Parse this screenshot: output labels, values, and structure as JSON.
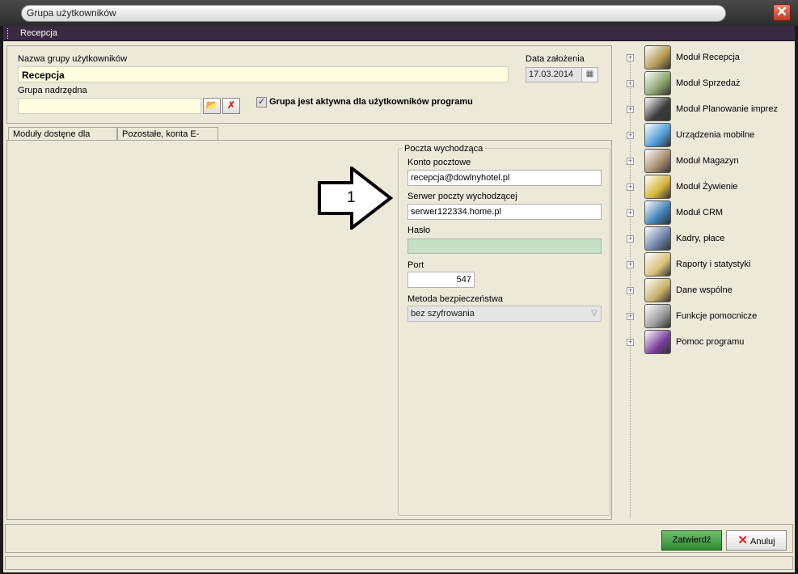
{
  "window": {
    "title": "Grupa użytkowników",
    "close_glyph": "✕"
  },
  "menubar": {
    "label": "Recepcja"
  },
  "form": {
    "name_label": "Nazwa grupy użytkowników",
    "name_value": "Recepcja",
    "parent_label": "Grupa nadrzędna",
    "parent_value": "",
    "date_label": "Data założenia",
    "date_value": "17.03.2014",
    "active_checked": true,
    "active_label": "Grupa jest aktywna dla użytkowników programu"
  },
  "tabs": [
    {
      "label": "Moduły dostęne dla grupy"
    },
    {
      "label": "Pozostałe, konta E-mail"
    }
  ],
  "mail": {
    "group_title": "Poczta wychodząca",
    "account_label": "Konto pocztowe",
    "account_value": "recepcja@dowlnyhotel.pl",
    "server_label": "Serwer poczty wychodzącej",
    "server_value": "serwer122334.home.pl",
    "password_label": "Hasło",
    "port_label": "Port",
    "port_value": "547",
    "security_label": "Metoda bezpieczeństwa",
    "security_value": "bez szyfrowania"
  },
  "annotation": {
    "number": "1"
  },
  "modules": [
    {
      "label": "Moduł Recepcja",
      "icon": "keys-icon",
      "color": "#b59a52"
    },
    {
      "label": "Moduł Sprzedaż",
      "icon": "money-icon",
      "color": "#8aa36a"
    },
    {
      "label": "Moduł Planowanie imprez",
      "icon": "event-icon",
      "color": "#3b3b3b"
    },
    {
      "label": "Urządzenia mobilne",
      "icon": "mobile-icon",
      "color": "#4f9bd8"
    },
    {
      "label": "Moduł Magazyn",
      "icon": "warehouse-icon",
      "color": "#a38b6a"
    },
    {
      "label": "Moduł Żywienie",
      "icon": "food-icon",
      "color": "#d4b43a"
    },
    {
      "label": "Moduł CRM",
      "icon": "crm-icon",
      "color": "#3d7fb5"
    },
    {
      "label": "Kadry, płace",
      "icon": "people-icon",
      "color": "#6b7fa8"
    },
    {
      "label": "Raporty i statystyki",
      "icon": "report-icon",
      "color": "#d8c27a"
    },
    {
      "label": "Dane wspólne",
      "icon": "shared-data-icon",
      "color": "#c9b06a"
    },
    {
      "label": "Funkcje pomocnicze",
      "icon": "tools-icon",
      "color": "#9a9a9a"
    },
    {
      "label": "Pomoc programu",
      "icon": "help-book-icon",
      "color": "#7a3f9a"
    }
  ],
  "buttons": {
    "confirm": "Zatwierdź",
    "cancel": "Anuluj"
  }
}
